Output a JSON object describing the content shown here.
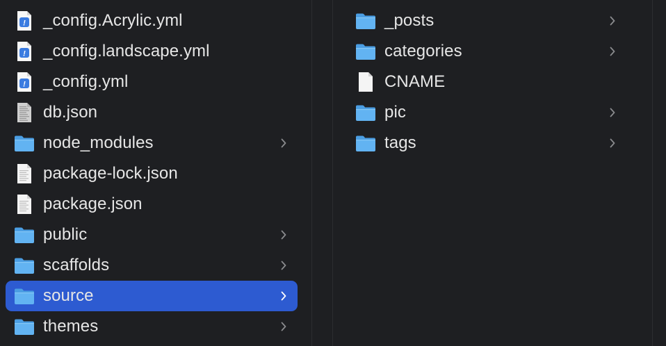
{
  "column1": {
    "items": [
      {
        "label": "_config.Acrylic.yml",
        "icon": "yaml-file-icon",
        "type": "file",
        "expandable": false,
        "selected": false
      },
      {
        "label": "_config.landscape.yml",
        "icon": "yaml-file-icon",
        "type": "file",
        "expandable": false,
        "selected": false
      },
      {
        "label": "_config.yml",
        "icon": "yaml-file-icon",
        "type": "file",
        "expandable": false,
        "selected": false
      },
      {
        "label": "db.json",
        "icon": "binary-file-icon",
        "type": "file",
        "expandable": false,
        "selected": false
      },
      {
        "label": "node_modules",
        "icon": "folder-icon",
        "type": "folder",
        "expandable": true,
        "selected": false
      },
      {
        "label": "package-lock.json",
        "icon": "text-file-icon",
        "type": "file",
        "expandable": false,
        "selected": false
      },
      {
        "label": "package.json",
        "icon": "text-file-icon",
        "type": "file",
        "expandable": false,
        "selected": false
      },
      {
        "label": "public",
        "icon": "folder-icon",
        "type": "folder",
        "expandable": true,
        "selected": false
      },
      {
        "label": "scaffolds",
        "icon": "folder-icon",
        "type": "folder",
        "expandable": true,
        "selected": false
      },
      {
        "label": "source",
        "icon": "folder-icon",
        "type": "folder",
        "expandable": true,
        "selected": true
      },
      {
        "label": "themes",
        "icon": "folder-icon",
        "type": "folder",
        "expandable": true,
        "selected": false
      }
    ]
  },
  "column2": {
    "items": [
      {
        "label": "_posts",
        "icon": "folder-icon",
        "type": "folder",
        "expandable": true,
        "selected": false
      },
      {
        "label": "categories",
        "icon": "folder-icon",
        "type": "folder",
        "expandable": true,
        "selected": false
      },
      {
        "label": "CNAME",
        "icon": "blank-file-icon",
        "type": "file",
        "expandable": false,
        "selected": false
      },
      {
        "label": "pic",
        "icon": "folder-icon",
        "type": "folder",
        "expandable": true,
        "selected": false
      },
      {
        "label": "tags",
        "icon": "folder-icon",
        "type": "folder",
        "expandable": true,
        "selected": false
      }
    ]
  },
  "colors": {
    "background": "#1e1f22",
    "selection": "#2d5bd1",
    "text": "#e6e6e6",
    "folder": "#5aaef0",
    "chevron": "#8a8b8e"
  }
}
